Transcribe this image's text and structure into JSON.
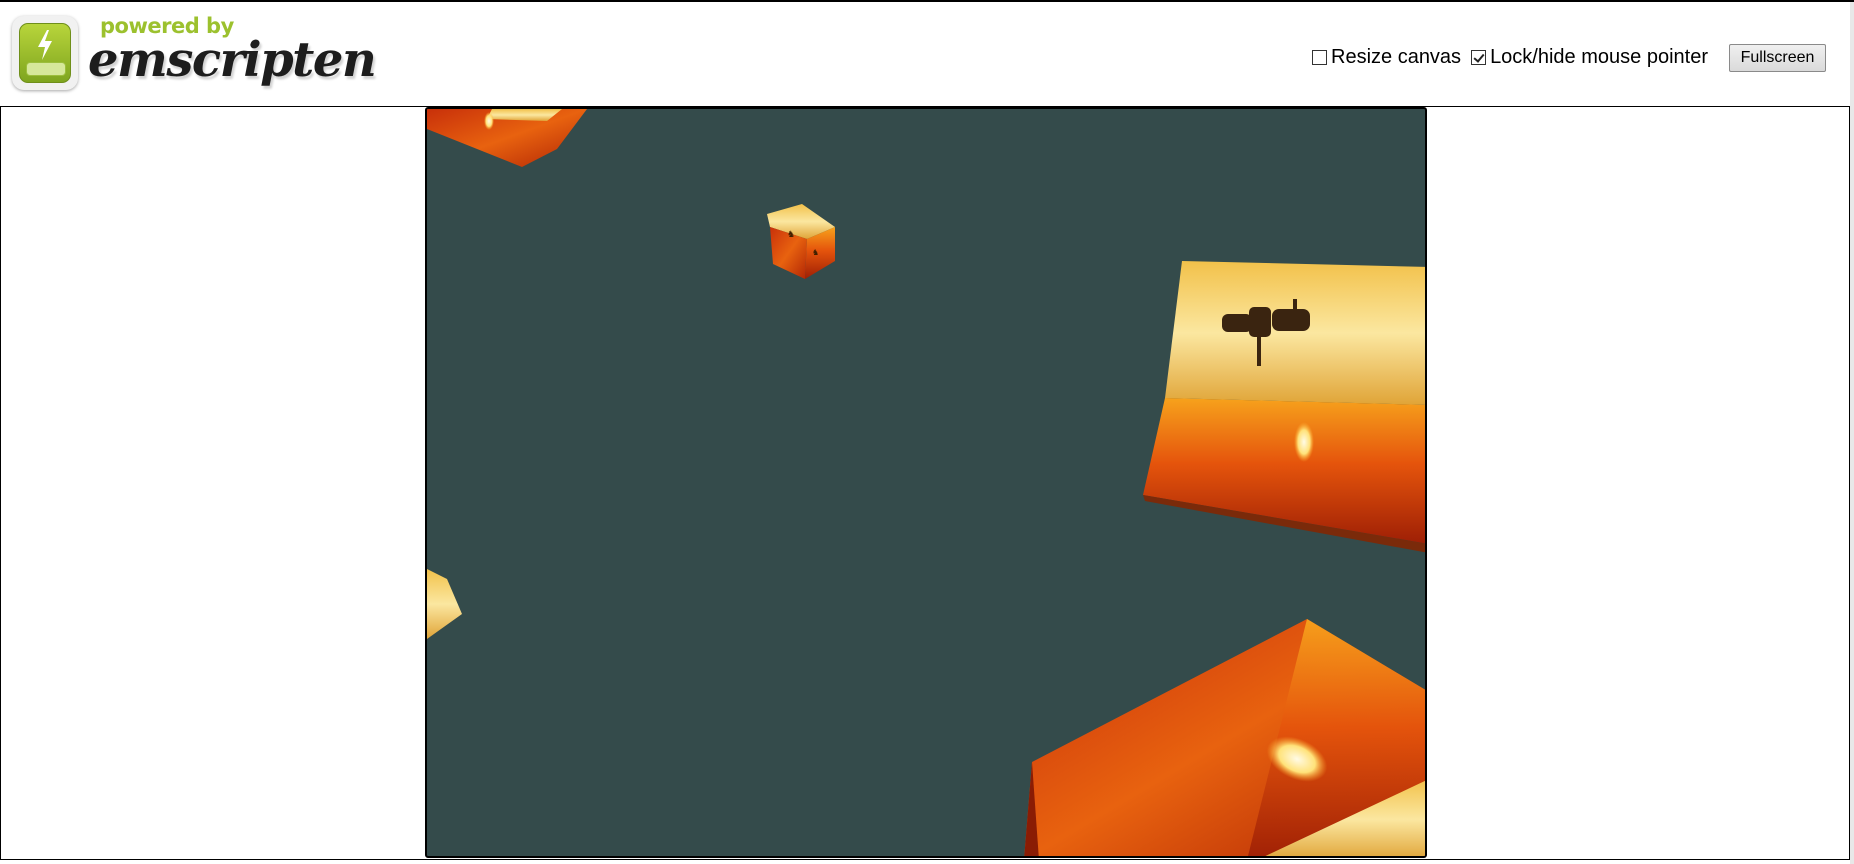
{
  "header": {
    "logo": {
      "powered_text": "powered by",
      "brand_text": "emscripten",
      "icon": "lightning-bolt-icon"
    },
    "controls": {
      "resize_canvas": {
        "label": "Resize canvas",
        "checked": false
      },
      "lock_pointer": {
        "label": "Lock/hide mouse pointer",
        "checked": true
      },
      "fullscreen_label": "Fullscreen"
    }
  },
  "canvas": {
    "background_color": "#344b4b",
    "scene": "rotating textured cubes (sunset / zebra photo textures)"
  }
}
